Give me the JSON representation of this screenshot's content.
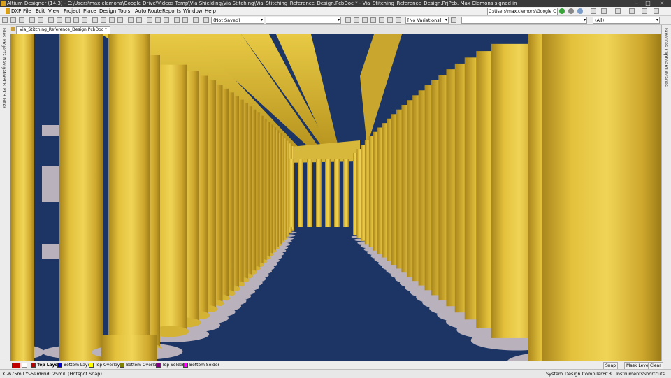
{
  "window": {
    "title": "Altium Designer (14.3) - C:\\Users\\max.clemons\\Google Drive\\Videos Temp\\Via Shielding\\Via Stitching\\Via_Stitching_Reference_Design.PcbDoc * - Via_Stitching_Reference_Design.PrjPcb. Max Clemons signed in",
    "controls": [
      "–",
      "□",
      "×"
    ]
  },
  "menu": {
    "items": [
      {
        "id": "dxp",
        "label": "DXP"
      },
      {
        "id": "file",
        "label": "File"
      },
      {
        "id": "edit",
        "label": "Edit"
      },
      {
        "id": "view",
        "label": "View"
      },
      {
        "id": "project",
        "label": "Project"
      },
      {
        "id": "place",
        "label": "Place"
      },
      {
        "id": "design",
        "label": "Design"
      },
      {
        "id": "tools",
        "label": "Tools"
      },
      {
        "id": "autoroute",
        "label": "Auto Route"
      },
      {
        "id": "reports",
        "label": "Reports"
      },
      {
        "id": "window",
        "label": "Window"
      },
      {
        "id": "help",
        "label": "Help"
      }
    ],
    "path": "C:\\Users\\max.clemons\\Google C"
  },
  "toolbar": {
    "saved_state": "(Not Saved)",
    "variations": "[No Variations]",
    "filter": "(All)"
  },
  "document": {
    "tab_label": "Via_Stitching_Reference_Design.PcbDoc *"
  },
  "left_panels": [
    "Files",
    "Projects",
    "Navigator",
    "PCB",
    "PCB Filter"
  ],
  "right_panels": [
    "Favorites",
    "Clipboard",
    "Libraries"
  ],
  "layers": [
    {
      "id": "top-layer",
      "label": "Top Layer",
      "color": "#c00000",
      "active": true
    },
    {
      "id": "bottom-layer",
      "label": "Bottom Layer",
      "color": "#0000c8"
    },
    {
      "id": "top-overlay",
      "label": "Top Overlay",
      "color": "#ffff00"
    },
    {
      "id": "bottom-overlay",
      "label": "Bottom Overlay",
      "color": "#808000"
    },
    {
      "id": "top-solder",
      "label": "Top Solder",
      "color": "#800080"
    },
    {
      "id": "bottom-solder",
      "label": "Bottom Solder",
      "color": "#ff00ff"
    }
  ],
  "layer_controls": {
    "snap": "Snap",
    "mask_level": "Mask Level",
    "clear": "Clear"
  },
  "status": {
    "coords": "X:-675mil Y:-59mil",
    "grid": "Grid: 25mil",
    "snap": "(Hotspot Snap)",
    "buttons": [
      "System",
      "Design Compiler",
      "PCB",
      "Instruments",
      "Shortcuts"
    ]
  },
  "colors": {
    "board": "#1c3564",
    "via_barrel": "#e3c13c",
    "via_shade": "#b08e22",
    "via_highlight": "#f3d85c",
    "pad": "#b8b0b8",
    "active_layer": "#c00000"
  }
}
